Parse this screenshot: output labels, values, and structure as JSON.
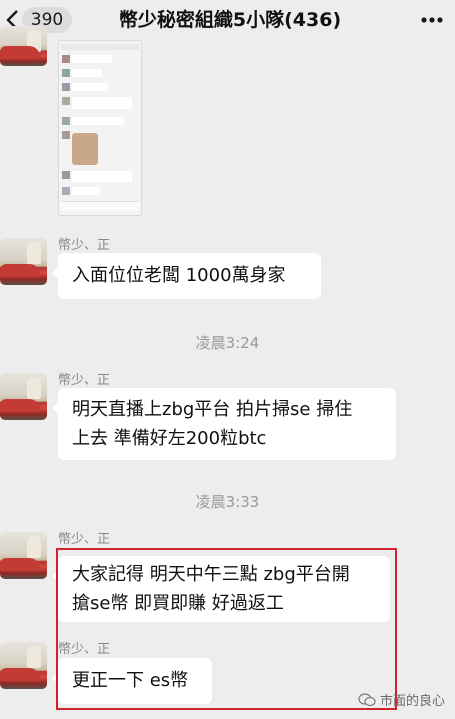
{
  "header": {
    "unread_count": "390",
    "title": "幣少秘密組織5小隊(436)"
  },
  "timestamps": [
    "凌晨3:24",
    "凌晨3:33"
  ],
  "messages": [
    {
      "sender": "幣少、正",
      "text": "入面位位老闆 1000萬身家"
    },
    {
      "sender": "幣少、正",
      "line1": "明天直播上zbg平台 拍片掃se 掃住",
      "line2": "上去 準備好左200粒btc"
    },
    {
      "sender": "幣少、正",
      "line1": "大家記得 明天中午三點 zbg平台開",
      "line2": "搶se幣 即買即賺 好過返工"
    },
    {
      "sender": "幣少、正",
      "text": "更正一下 es幣"
    }
  ],
  "watermark": {
    "text": "市面的良心"
  },
  "icons": [
    "back-arrow-icon",
    "more-dots-icon",
    "wechat-icon"
  ],
  "colors": {
    "background": "#ededed",
    "bubble": "#ffffff",
    "highlight": "#d0232b"
  }
}
